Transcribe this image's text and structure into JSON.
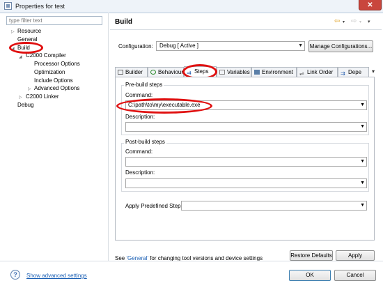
{
  "window": {
    "title": "Properties for test",
    "close_glyph": "✕"
  },
  "filter": {
    "placeholder": "type filter text"
  },
  "tree": {
    "resource": "Resource",
    "general": "General",
    "build": "Build",
    "c2000_compiler": "C2000 Compiler",
    "processor_options": "Processor Options",
    "optimization": "Optimization",
    "include_options": "Include Options",
    "advanced_options": "Advanced Options",
    "c2000_linker": "C2000 Linker",
    "debug": "Debug"
  },
  "page": {
    "title": "Build"
  },
  "config": {
    "label": "Configuration:",
    "value": "Debug  [ Active ]",
    "manage_button": "Manage Configurations..."
  },
  "tabs": {
    "builder": "Builder",
    "behaviour": "Behaviour",
    "steps": "Steps",
    "variables": "Variables",
    "environment": "Environment",
    "link_order": "Link Order",
    "dependencies": "Depe"
  },
  "pre_build": {
    "title": "Pre-build steps",
    "command_label": "Command:",
    "command_value": "C:\\path\\to\\my\\executable.exe",
    "description_label": "Description:",
    "description_value": ""
  },
  "post_build": {
    "title": "Post-build steps",
    "command_label": "Command:",
    "command_value": "",
    "description_label": "Description:",
    "description_value": ""
  },
  "predefined": {
    "label": "Apply Predefined Step:",
    "value": ""
  },
  "footer": {
    "see": "See ",
    "link": "'General'",
    "rest": " for changing tool versions and device settings",
    "restore_defaults": "Restore Defaults",
    "apply": "Apply",
    "advanced_link": "Show advanced settings",
    "ok": "OK",
    "cancel": "Cancel"
  },
  "colors": {
    "annotation": "#e01010",
    "link": "#1a5fb4",
    "close": "#c9463d"
  }
}
